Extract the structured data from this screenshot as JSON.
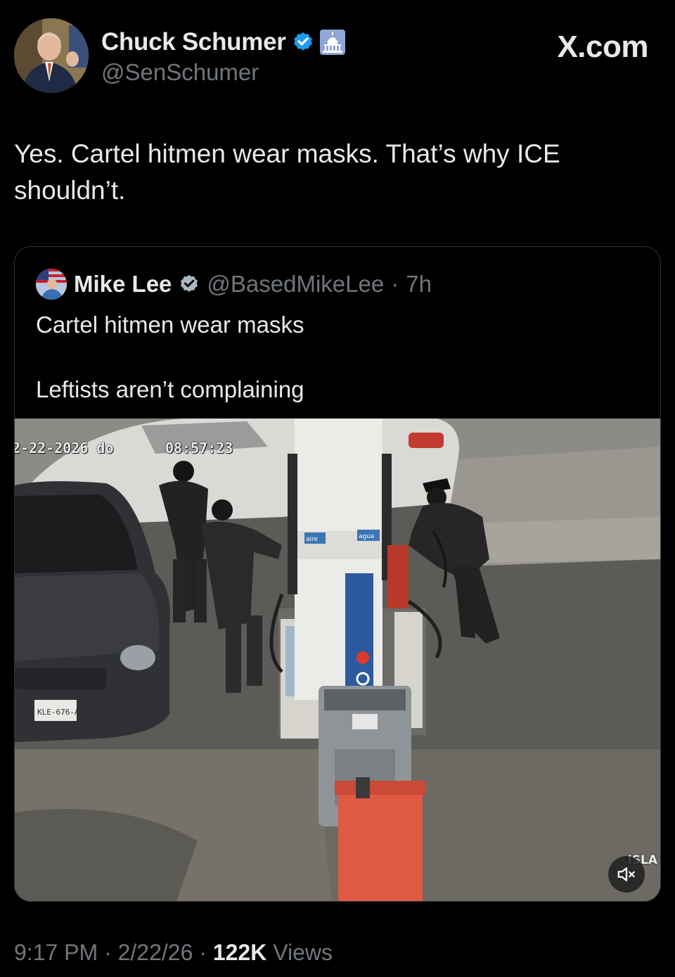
{
  "author": {
    "name": "Chuck Schumer",
    "handle": "@SenSchumer",
    "avatar_icon": "person-avatar",
    "badges": [
      "verified-badge-icon",
      "capitol-building-icon"
    ]
  },
  "brand": {
    "label": "X.com"
  },
  "tweet": {
    "text": "Yes. Cartel hitmen wear masks. That’s why ICE shouldn’t."
  },
  "quoted_tweet": {
    "name": "Mike Lee",
    "handle": "@BasedMikeLee",
    "separator": "·",
    "age": "7h",
    "lines": [
      "Cartel hitmen wear masks",
      "Leftists aren’t complaining"
    ],
    "media": {
      "type": "video",
      "overlay_date": "2-22-2026 do",
      "overlay_time": "08:57:23",
      "pump_label_left": "aire",
      "pump_label_right": "agua",
      "plate": "KLE-676-A",
      "camera_label": "ISLA",
      "mute_icon": "speaker-muted-icon"
    }
  },
  "footer": {
    "time": "9:17 PM",
    "date": "2/22/26",
    "separator": "·",
    "views_count": "122K",
    "views_label": "Views"
  },
  "colors": {
    "background": "#000000",
    "text_primary": "#e7e9ea",
    "text_secondary": "#71767b",
    "verified": "#1d9bf0",
    "card_border": "#2f3336"
  }
}
